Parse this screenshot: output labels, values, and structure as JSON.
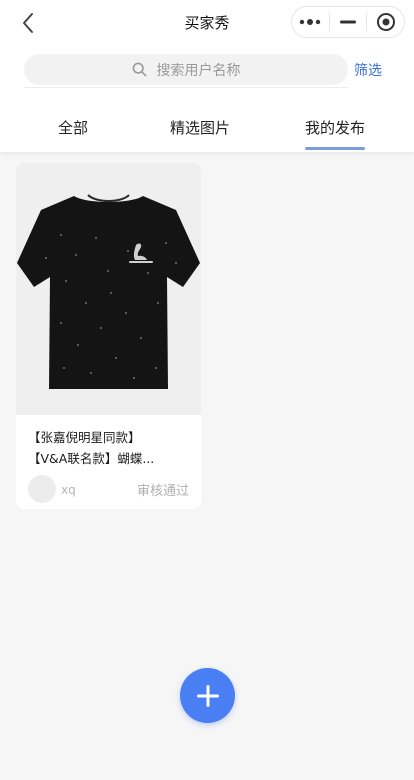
{
  "nav": {
    "title": "买家秀",
    "back_icon": "chevron-left-icon",
    "capsule": {
      "more_icon": "more-dots-icon",
      "minimize_icon": "minimize-icon",
      "close_icon": "target-close-icon"
    }
  },
  "search": {
    "placeholder": "搜索用户名称",
    "icon": "search-icon",
    "filter_label": "筛选"
  },
  "tabs": [
    {
      "label": "全部",
      "active": false
    },
    {
      "label": "精选图片",
      "active": false
    },
    {
      "label": "我的发布",
      "active": true
    }
  ],
  "colors": {
    "accent": "#3b6fd9",
    "tab_indicator": "#7a9de0",
    "fab": "#4a7ff3",
    "background": "#f6f6f6"
  },
  "posts": [
    {
      "image": "black-tshirt-photo",
      "title_line1": "【张嘉倪明星同款】",
      "title_line2": "【V&A联名款】蝴蝶...",
      "username": "xq",
      "status": "审核通过"
    }
  ],
  "fab": {
    "icon": "plus-icon"
  }
}
